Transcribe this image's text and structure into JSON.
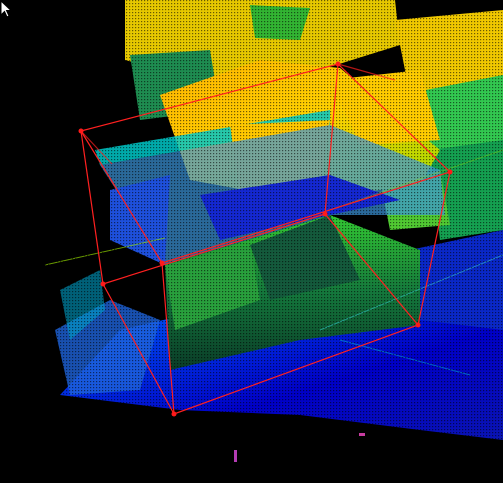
{
  "viewer": {
    "background": "#000000",
    "colormap": [
      "#0000c8",
      "#0064ff",
      "#00c8c8",
      "#32c832",
      "#96dc00",
      "#ffd200",
      "#ffb400"
    ],
    "bounding_box": {
      "color": "#ff2020",
      "handle_color": "#ff1a1a"
    },
    "icons": [
      "bounding-box",
      "mouse-pointer-icon"
    ]
  }
}
